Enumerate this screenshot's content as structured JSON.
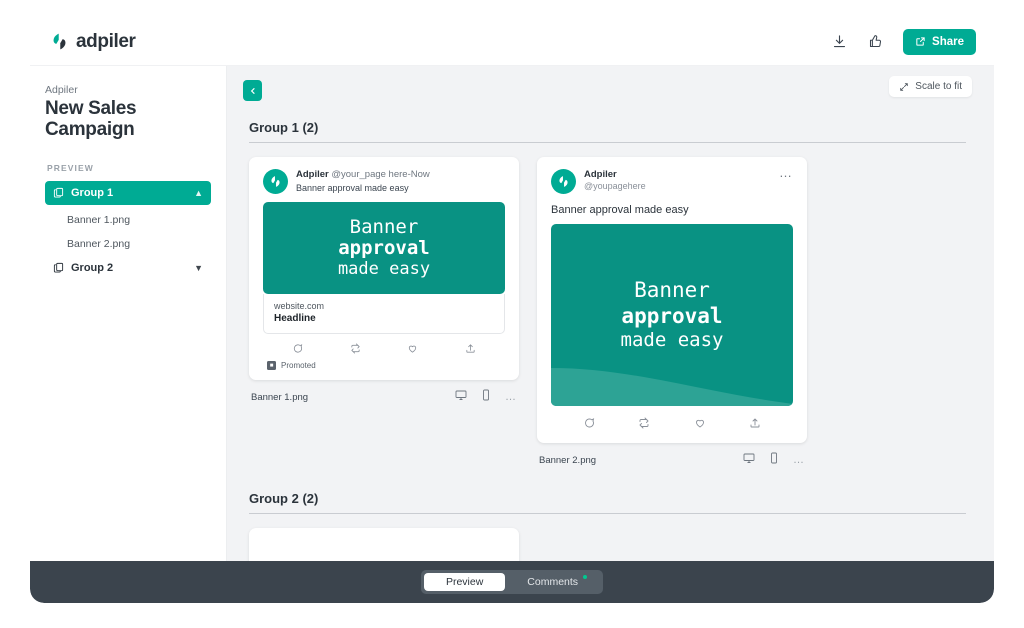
{
  "brand": {
    "name": "adpiler",
    "logo_icon": "adpiler-logo-icon",
    "accent": "#00ab94"
  },
  "topbar": {
    "download_icon": "download-icon",
    "thumbsup_icon": "thumbs-up-icon",
    "share_label": "Share",
    "share_icon": "external-link-icon"
  },
  "sidebar": {
    "account": "Adpiler",
    "campaign": "New Sales Campaign",
    "section_label": "PREVIEW",
    "groups": [
      {
        "label": "Group 1",
        "icon": "copy-icon",
        "chevron": "chevron-up-icon",
        "active": true,
        "files": [
          "Banner 1.png",
          "Banner 2.png"
        ]
      },
      {
        "label": "Group 2",
        "icon": "copy-icon",
        "chevron": "chevron-down-icon",
        "active": false,
        "files": []
      }
    ]
  },
  "canvas": {
    "collapse_icon": "chevron-left-icon",
    "scale_label": "Scale to fit",
    "scale_icon": "expand-icon",
    "group1_heading": "Group 1 (2)",
    "group2_heading": "Group 2 (2)"
  },
  "creative": {
    "line1": "Banner",
    "line2": "approval",
    "line3": "made easy",
    "bg_color": "#099283",
    "wave_color": "#2da395"
  },
  "facebook_ad": {
    "page_name": "Adpiler",
    "meta": "@your_page here-Now",
    "caption": "Banner approval made easy",
    "link_url": "website.com",
    "headline": "Headline",
    "actions": [
      "comment-icon",
      "repost-icon",
      "like-icon",
      "share-icon"
    ],
    "promoted_label": "Promoted",
    "promoted_badge": "ad-badge-icon",
    "file_name": "Banner 1.png",
    "view_icons": [
      "desktop-icon",
      "mobile-icon",
      "more-icon"
    ]
  },
  "twitter_ad": {
    "page_name": "Adpiler",
    "handle": "@youpagehere",
    "more_icon": "more-icon",
    "caption": "Banner approval made easy",
    "actions": [
      "comment-icon",
      "repost-icon",
      "like-icon",
      "share-icon"
    ],
    "file_name": "Banner 2.png",
    "view_icons": [
      "desktop-icon",
      "mobile-icon",
      "more-icon"
    ]
  },
  "bottombar": {
    "tabs": [
      {
        "label": "Preview",
        "active": true,
        "badge": false
      },
      {
        "label": "Comments",
        "active": false,
        "badge": true
      }
    ]
  }
}
